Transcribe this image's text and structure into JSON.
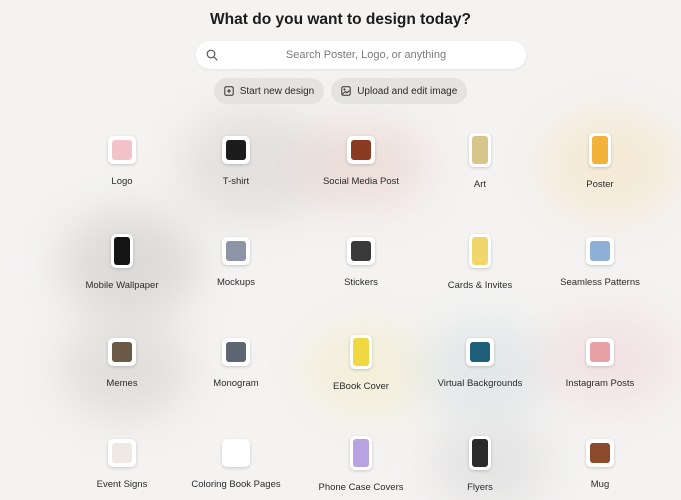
{
  "heading": "What do you want to design today?",
  "search": {
    "placeholder": "Search Poster, Logo, or anything"
  },
  "actions": [
    {
      "label": "Start new design",
      "icon": "new-design-icon"
    },
    {
      "label": "Upload and edit image",
      "icon": "upload-image-icon"
    }
  ],
  "categories": [
    {
      "label": "Logo",
      "icon": "logo-thumbnail",
      "color": "#f3c3c9"
    },
    {
      "label": "T-shirt",
      "icon": "tshirt-thumbnail",
      "color": "#1c1c1c"
    },
    {
      "label": "Social Media Post",
      "icon": "social-post-thumbnail",
      "color": "#8a3b22"
    },
    {
      "label": "Art",
      "icon": "art-thumbnail",
      "color": "#d7c58c"
    },
    {
      "label": "Poster",
      "icon": "poster-thumbnail",
      "color": "#f2b33a"
    },
    {
      "label": "Mobile Wallpaper",
      "icon": "wallpaper-thumbnail",
      "color": "#141414"
    },
    {
      "label": "Mockups",
      "icon": "mockups-thumbnail",
      "color": "#8c96a6"
    },
    {
      "label": "Stickers",
      "icon": "stickers-thumbnail",
      "color": "#3a3a3a"
    },
    {
      "label": "Cards & Invites",
      "icon": "cards-thumbnail",
      "color": "#f1d66c"
    },
    {
      "label": "Seamless Patterns",
      "icon": "patterns-thumbnail",
      "color": "#8fb0d6"
    },
    {
      "label": "Memes",
      "icon": "memes-thumbnail",
      "color": "#6b5a45"
    },
    {
      "label": "Monogram",
      "icon": "monogram-thumbnail",
      "color": "#5d6672"
    },
    {
      "label": "EBook Cover",
      "icon": "ebook-thumbnail",
      "color": "#f0d842"
    },
    {
      "label": "Virtual Backgrounds",
      "icon": "virtual-bg-thumbnail",
      "color": "#1f5f7a"
    },
    {
      "label": "Instagram Posts",
      "icon": "instagram-thumbnail",
      "color": "#e7a0a4"
    },
    {
      "label": "Event Signs",
      "icon": "event-signs-thumbnail",
      "color": "#efe9e4"
    },
    {
      "label": "Coloring Book Pages",
      "icon": "coloring-thumbnail",
      "color": "#ffffff"
    },
    {
      "label": "Phone Case Covers",
      "icon": "phone-case-thumbnail",
      "color": "#b9a2e0"
    },
    {
      "label": "Flyers",
      "icon": "flyers-thumbnail",
      "color": "#2b2b2b"
    },
    {
      "label": "Mug",
      "icon": "mug-thumbnail",
      "color": "#8b4a2b"
    }
  ]
}
